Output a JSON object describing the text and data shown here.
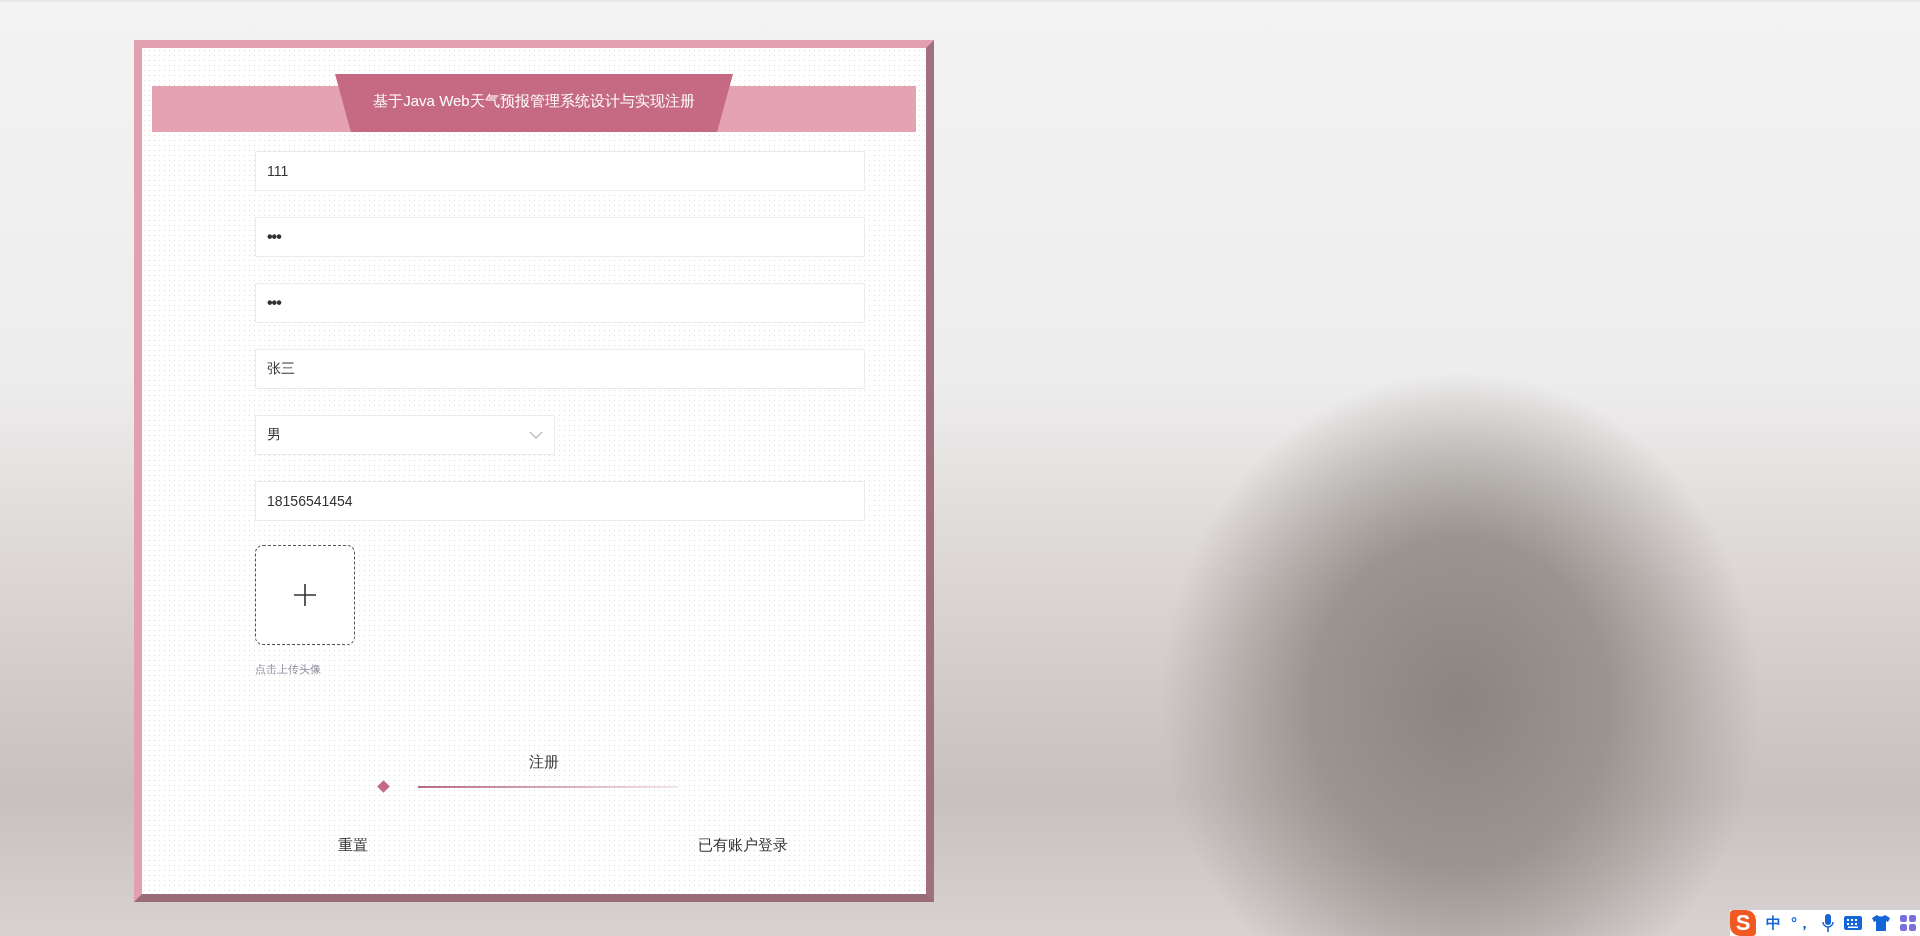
{
  "title": "基于Java Web天气预报管理系统设计与实现注册",
  "fields": [
    {
      "kind": "text",
      "value": "111"
    },
    {
      "kind": "password",
      "value": "•••"
    },
    {
      "kind": "password",
      "value": "•••"
    },
    {
      "kind": "text",
      "value": "张三"
    },
    {
      "kind": "select",
      "value": "男"
    },
    {
      "kind": "text",
      "value": "18156541454"
    }
  ],
  "upload": {
    "hint": "点击上传头像"
  },
  "submit": "注册",
  "reset": "重置",
  "login_link": "已有账户登录",
  "ime": {
    "logo": "S",
    "mode": "中",
    "punct": "°，"
  }
}
